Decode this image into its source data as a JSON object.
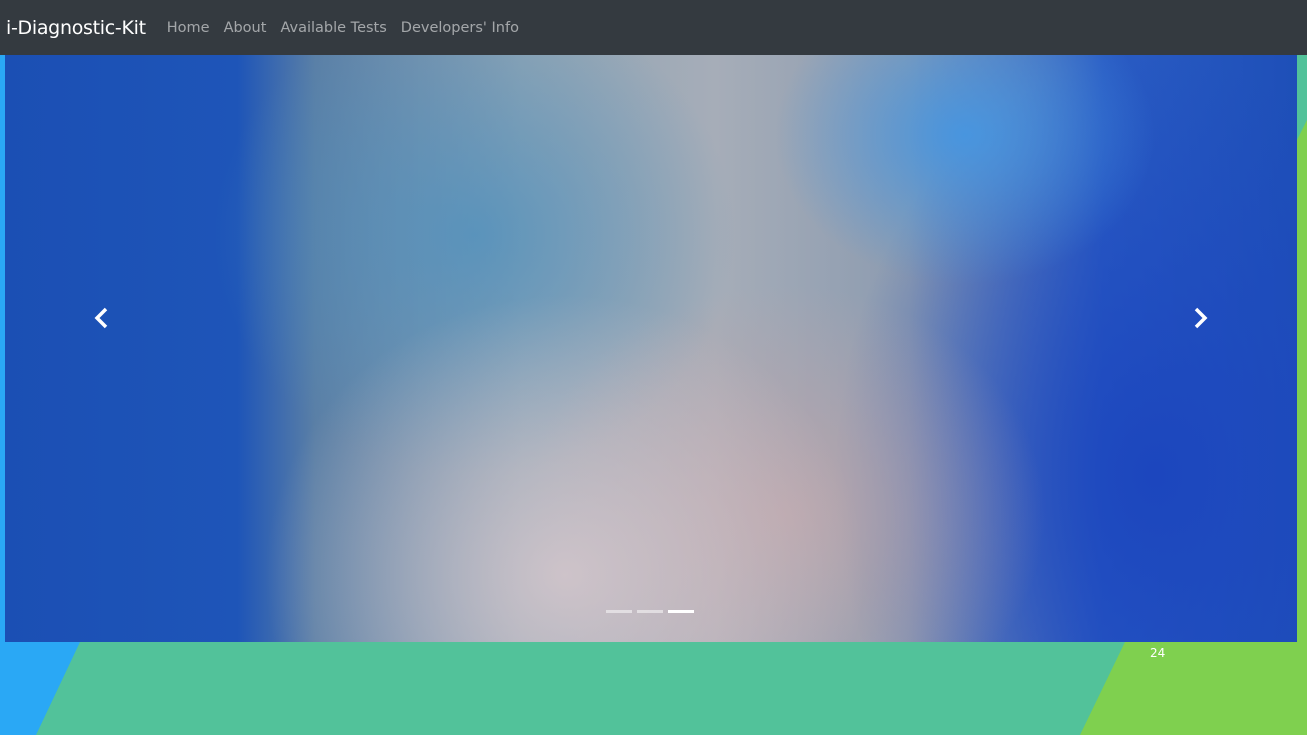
{
  "navbar": {
    "brand": "i-Diagnostic-Kit",
    "links": [
      "Home",
      "About",
      "Available Tests",
      "Developers' Info"
    ]
  },
  "carousel": {
    "slide_count": 3,
    "active_index": 2,
    "prev_icon": "chevron-left-icon",
    "next_icon": "chevron-right-icon"
  },
  "slide_footer": {
    "page_number": "24"
  },
  "colors": {
    "navbar": "#343a40",
    "accent_blue": "#2aa8f5",
    "accent_teal": "#52c29a",
    "accent_green": "#7fd04f"
  }
}
